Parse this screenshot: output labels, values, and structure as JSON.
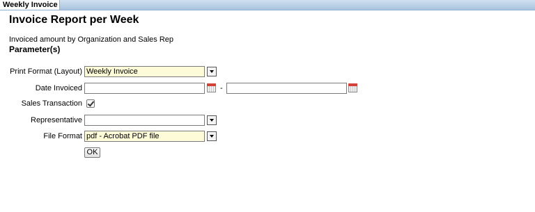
{
  "tab": {
    "label": "Weekly Invoice"
  },
  "page": {
    "title": "Invoice Report per Week",
    "description": "Invoiced amount by Organization and Sales Rep",
    "section_title": "Parameter(s)"
  },
  "params": {
    "print_format": {
      "label": "Print Format (Layout)",
      "value": "Weekly Invoice"
    },
    "date_invoiced": {
      "label": "Date Invoiced",
      "from": "",
      "to": "",
      "separator": "-"
    },
    "sales_transaction": {
      "label": "Sales Transaction",
      "checked": true
    },
    "representative": {
      "label": "Representative",
      "value": ""
    },
    "file_format": {
      "label": "File Format",
      "value": "pdf - Acrobat PDF file"
    }
  },
  "buttons": {
    "ok_label": "OK"
  },
  "colors": {
    "mandatory_bg": "#fdfbd8",
    "tab_bar": "#a9c4df"
  }
}
